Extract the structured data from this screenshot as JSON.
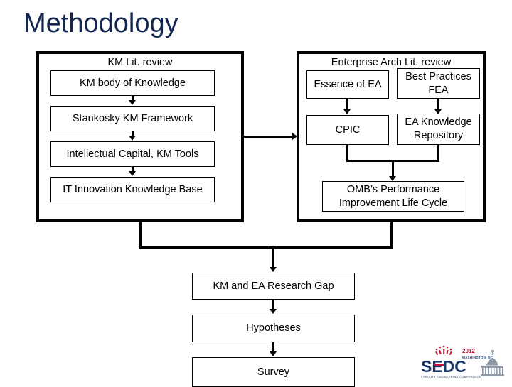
{
  "slide": {
    "title": "Methodology",
    "title_color": "#12264f",
    "background": "#ffffff",
    "line_color": "#000000"
  },
  "diagram": {
    "type": "flowchart",
    "groups": [
      {
        "id": "km-lit-review",
        "label": "KM Lit. review",
        "nodes": [
          {
            "id": "km-body-of-knowledge",
            "label": "KM body of Knowledge"
          },
          {
            "id": "stankosky-km-framework",
            "label": "Stankosky KM Framework"
          },
          {
            "id": "intellectual-capital-km-tools",
            "label": "Intellectual Capital, KM Tools"
          },
          {
            "id": "it-innovation-knowledge-base",
            "label": "IT Innovation Knowledge Base"
          }
        ]
      },
      {
        "id": "enterprise-arch-lit-review",
        "label": "Enterprise Arch Lit. review",
        "nodes": [
          {
            "id": "essence-of-ea",
            "label": "Essence of EA"
          },
          {
            "id": "best-practices-fea",
            "label": "Best Practices FEA"
          },
          {
            "id": "cpic",
            "label": "CPIC"
          },
          {
            "id": "ea-knowledge-repository",
            "label": "EA Knowledge Repository"
          },
          {
            "id": "ombs-performance-improvement-life-cycle",
            "label": "OMB’s Performance Improvement Life Cycle"
          }
        ]
      }
    ],
    "outcome_nodes": [
      {
        "id": "km-and-ea-research-gap",
        "label": "KM and EA Research Gap"
      },
      {
        "id": "hypotheses",
        "label": "Hypotheses"
      },
      {
        "id": "survey",
        "label": "Survey"
      }
    ]
  },
  "logo": {
    "name": "sedc-conference-logo",
    "acronym": "SEDC",
    "year": "2012",
    "location": "WASHINGTON, DC",
    "tagline": "SYSTEMS ENGINEERING CONFERENCE",
    "red": "#c8102e",
    "navy": "#1b3a6b"
  }
}
